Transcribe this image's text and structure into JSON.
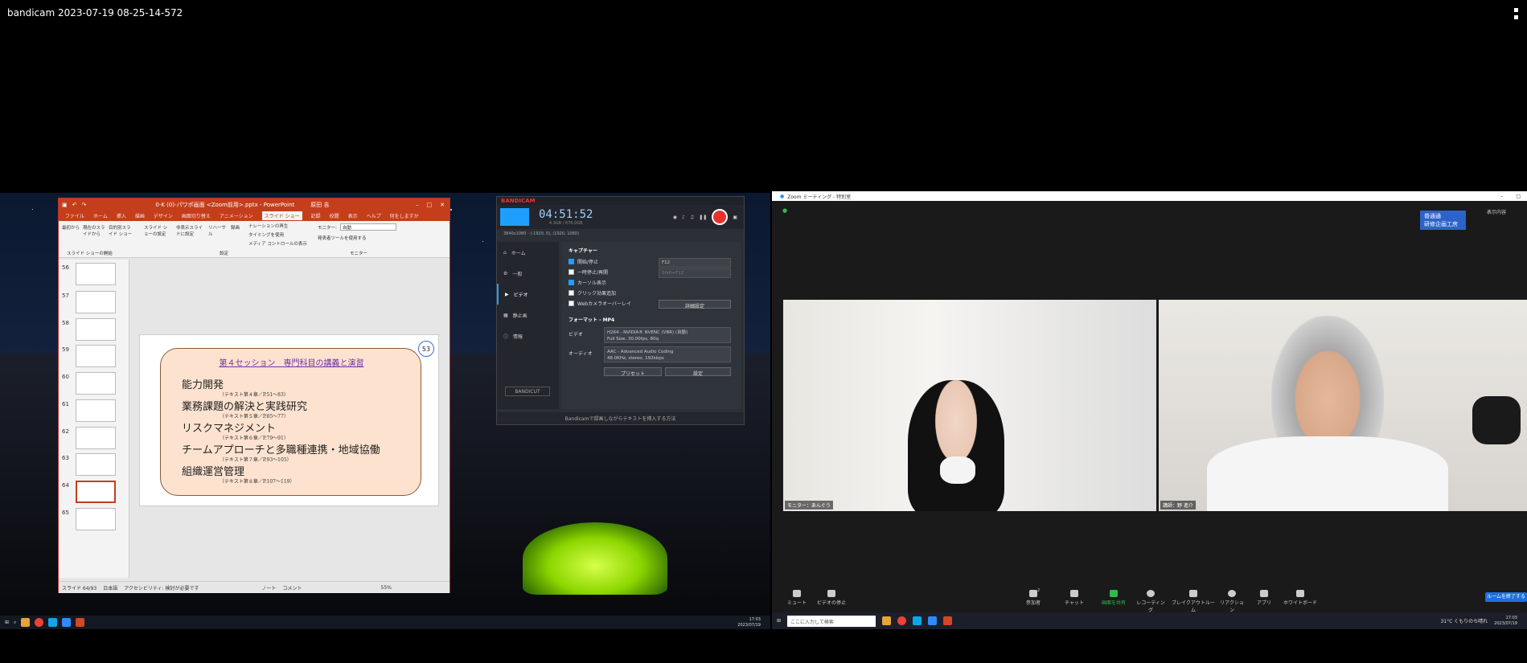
{
  "recording_title": "bandicam 2023-07-19 08-25-14-572",
  "ppt": {
    "title": "0-K (0)-パワポ画面 <Zoom前用>.pptx - PowerPoint",
    "user": "原田 吉",
    "tabs": [
      "ファイル",
      "ホーム",
      "挿入",
      "描画",
      "デザイン",
      "画面切り替え",
      "アニメーション",
      "スライド ショー",
      "記録",
      "校閲",
      "表示",
      "ヘルプ",
      "何をしますか"
    ],
    "selected_tab": "スライド ショー",
    "ribbon": {
      "from_start": "最初から",
      "from_current": "現在のスライドから",
      "custom": "目的別スライド ショー",
      "group_start": "スライド ショーの開始",
      "setup": "スライド ショーの設定",
      "hide": "非表示スライドに設定",
      "rehearse": "リハーサル",
      "record": "録画",
      "narration": "ナレーションの再生",
      "timing": "タイミングを使用",
      "media_controls": "メディア コントロールの表示",
      "group_setup": "設定",
      "monitor_label": "モニター:",
      "monitor_value": "自動",
      "presenter_view": "発表者ツールを使用する",
      "group_monitor": "モニター"
    },
    "thumbnails": [
      "56",
      "57",
      "58",
      "59",
      "60",
      "61",
      "62",
      "63",
      "64",
      "65"
    ],
    "selected_slide": "64",
    "slide": {
      "heading": "第４セッション　専門科目の講義と演習",
      "number": "53",
      "topics": [
        {
          "title": "能力開発",
          "ref": "（テキスト第４章／P.51〜83）"
        },
        {
          "title": "業務課題の解決と実践研究",
          "ref": "（テキスト第５章／P.85〜77）"
        },
        {
          "title": "リスクマネジメント",
          "ref": "（テキスト第６章／P.79〜91）"
        },
        {
          "title": "チームアプローチと多職種連携・地域協働",
          "ref": "（テキスト第７章／P.93〜105）"
        },
        {
          "title": "組織運営管理",
          "ref": "（テキスト第８章／P.107〜119）"
        }
      ]
    },
    "status": {
      "slide_pos": "スライド 64/93",
      "lang": "日本語",
      "accessibility": "アクセシビリティ: 検討が必要です",
      "notes": "ノート",
      "comments": "コメント",
      "zoom": "55%"
    }
  },
  "bandicam": {
    "brand": "BANDICAM",
    "time": "04:51:52",
    "size": "4.3GB / 676.0GB",
    "region": "3840x1080 - (-1920, 0), (1920, 1080)",
    "nav": [
      "ホーム",
      "一般",
      "ビデオ",
      "静止画",
      "情報"
    ],
    "selected_nav": "ビデオ",
    "capture_header": "キャプチャー",
    "options": [
      {
        "label": "開始/停止",
        "checked": true
      },
      {
        "label": "一時停止/再開",
        "checked": false
      },
      {
        "label": "カーソル表示",
        "checked": true
      },
      {
        "label": "クリック効果追加",
        "checked": false
      },
      {
        "label": "Webカメラオーバーレイ",
        "checked": false
      }
    ],
    "hotkey1": "F12",
    "hotkey2": "Shift+F12",
    "advanced_btn": "詳細設定",
    "format_header": "フォーマット - MP4",
    "video_label": "ビデオ",
    "video_line1": "H264 - NVIDIA® NVENC (VBR) (自動)",
    "video_line2": "Full Size, 30.00fps, 80q",
    "audio_label": "オーディオ",
    "audio_line1": "AAC - Advanced Audio Coding",
    "audio_line2": "48.0KHz, stereo, 192kbps",
    "preset_btn": "プリセット",
    "settings_btn": "設定",
    "bandicut": "BANDICUT",
    "footer": "Bandicamで録画しながらテキストを挿入する方法"
  },
  "zoom": {
    "title": "Zoom ミーティング - 特別室",
    "badge_line1": "普通通",
    "badge_line2": "研修企画工房",
    "info": "表示内容",
    "participants": [
      {
        "name": "モニター：あんぐう"
      },
      {
        "name": "講師：野 進介"
      }
    ],
    "toolbar": [
      "ミュート",
      "ビデオの停止",
      "参加者",
      "チャット",
      "画面を共有",
      "レコーディング",
      "ブレイクアウトルーム",
      "リアクション",
      "アプリ",
      "ホワイトボード"
    ],
    "participant_count": "2",
    "leave_label": "ルームを終了する"
  },
  "taskbar_left": {
    "time": "17:03",
    "date": "2023/07/19"
  },
  "taskbar_right": {
    "search_placeholder": "ここに入力して検索",
    "weather": "31°C くもりのち晴れ",
    "time": "17:03",
    "date": "2023/07/19"
  },
  "colors": {
    "ppt_accent": "#c43e1c",
    "bandicam_record": "#e6332a",
    "zoom_blue": "#2d63c8"
  }
}
